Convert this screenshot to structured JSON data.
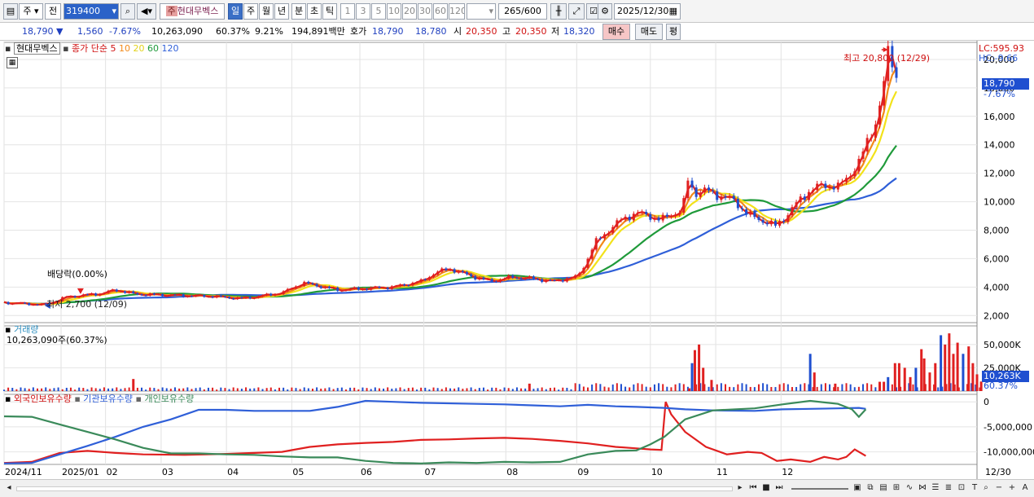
{
  "toolbar": {
    "market": "주",
    "prev": "전",
    "code": "319400",
    "stock_name": "현대무벡스",
    "periods": [
      "일",
      "주",
      "월",
      "년",
      "분",
      "초",
      "틱"
    ],
    "minutes": [
      "1",
      "3",
      "5",
      "10",
      "20",
      "30",
      "60",
      "120"
    ],
    "count": "265",
    "count_max": "/600",
    "date": "2025/12/30",
    "badge": "주"
  },
  "quote": {
    "price": "18,790",
    "change": "1,560",
    "change_pct": "-7.67%",
    "volume": "10,263,090",
    "vol_ratio": "60.37%",
    "turnover": "9.21%",
    "amount": "194,891백만",
    "bid_label": "호가",
    "ask": "18,790",
    "bid": "18,780",
    "open_label": "시",
    "open": "20,350",
    "high_label": "고",
    "high": "20,350",
    "low_label": "저",
    "low": "18,320",
    "buy": "매수",
    "sell": "매도",
    "eval": "평"
  },
  "legend": {
    "stock": "현대무벡스",
    "close_label": "종가 단순",
    "ma": [
      "5",
      "10",
      "20",
      "60",
      "120"
    ]
  },
  "annotations": {
    "max": "최고 20,800 (12/29)",
    "min": "최저 2,700 (12/09)",
    "dividend": "배당락(0.00%)",
    "lc": "LC:595.93",
    "hc": "HC:-9.66",
    "last_price": "18,790",
    "last_pct": "-7.67%"
  },
  "volume_panel": {
    "title": "거래량",
    "info": "10,263,090주(60.37%)",
    "last": "10,263K",
    "last_pct": "60.37%"
  },
  "holdings_panel": {
    "series": [
      "외국인보유수량",
      "기관보유수량",
      "개인보유수량"
    ]
  },
  "x_labels": [
    "2024/11",
    "2025/01",
    "02",
    "03",
    "04",
    "05",
    "06",
    "07",
    "08",
    "09",
    "10",
    "11",
    "12"
  ],
  "x_right": "12/30",
  "colors": {
    "up": "#e02020",
    "down": "#1f4fd0",
    "ma5": "#e02020",
    "ma10": "#f28a1a",
    "ma20": "#f2e21a",
    "ma60": "#1f9a3a",
    "ma120": "#2f5fd8",
    "foreign": "#e02020",
    "institution": "#2f5fd8",
    "individual": "#3a8a5a"
  },
  "chart_data": [
    {
      "type": "candlestick",
      "title": "현대무벡스",
      "ylim": [
        1500,
        21200
      ],
      "y_ticks": [
        2000,
        4000,
        6000,
        8000,
        10000,
        12000,
        14000,
        16000,
        18000,
        20000
      ],
      "y_tick_labels": [
        "2,000",
        "4,000",
        "6,000",
        "8,000",
        "10,000",
        "12,000",
        "14,000",
        "16,000",
        "18,000",
        "20,000"
      ],
      "x_months": [
        "2024/11",
        "2025/01",
        "02",
        "03",
        "04",
        "05",
        "06",
        "07",
        "08",
        "09",
        "10",
        "11",
        "12"
      ],
      "x_month_day": [
        0,
        41,
        73,
        113,
        160,
        207,
        256,
        302,
        361,
        412,
        465,
        512,
        559
      ],
      "close_points": [
        [
          0,
          2900
        ],
        [
          10,
          2850
        ],
        [
          20,
          2800
        ],
        [
          28,
          2750
        ],
        [
          35,
          2950
        ],
        [
          45,
          3300
        ],
        [
          55,
          3400
        ],
        [
          70,
          3550
        ],
        [
          80,
          3800
        ],
        [
          95,
          3500
        ],
        [
          110,
          3450
        ],
        [
          130,
          3400
        ],
        [
          150,
          3350
        ],
        [
          170,
          3200
        ],
        [
          180,
          3300
        ],
        [
          200,
          3600
        ],
        [
          215,
          4300
        ],
        [
          225,
          4100
        ],
        [
          240,
          3800
        ],
        [
          260,
          3900
        ],
        [
          280,
          4000
        ],
        [
          300,
          4400
        ],
        [
          310,
          5000
        ],
        [
          320,
          5300
        ],
        [
          335,
          4800
        ],
        [
          350,
          4400
        ],
        [
          365,
          4700
        ],
        [
          380,
          4600
        ],
        [
          395,
          4400
        ],
        [
          405,
          4600
        ],
        [
          412,
          4700
        ],
        [
          418,
          5600
        ],
        [
          425,
          7100
        ],
        [
          435,
          8000
        ],
        [
          445,
          8800
        ],
        [
          455,
          9200
        ],
        [
          465,
          9000
        ],
        [
          472,
          8700
        ],
        [
          480,
          9100
        ],
        [
          488,
          9400
        ],
        [
          492,
          11500
        ],
        [
          497,
          10600
        ],
        [
          505,
          10800
        ],
        [
          515,
          10400
        ],
        [
          525,
          10100
        ],
        [
          535,
          9100
        ],
        [
          545,
          8700
        ],
        [
          555,
          8300
        ],
        [
          563,
          9000
        ],
        [
          572,
          10100
        ],
        [
          580,
          10800
        ],
        [
          590,
          11200
        ],
        [
          600,
          11000
        ],
        [
          608,
          11900
        ],
        [
          615,
          12700
        ],
        [
          622,
          14500
        ],
        [
          628,
          15800
        ],
        [
          632,
          17500
        ],
        [
          636,
          20500
        ],
        [
          639,
          20000
        ],
        [
          642,
          18790
        ]
      ],
      "max_label": "최고 20,800 (12/29)",
      "min_label": "최저 2,700 (12/09)",
      "last_price": 18790,
      "last_change_pct": -7.67
    },
    {
      "type": "bar",
      "title": "거래량",
      "ylim": [
        0,
        70000
      ],
      "y_ticks": [
        25000,
        50000
      ],
      "y_tick_labels": [
        "25,000K",
        "50,000K"
      ],
      "spikes_k": [
        [
          93,
          13000
        ],
        [
          378,
          8000
        ],
        [
          493,
          3000
        ],
        [
          495,
          30000
        ],
        [
          497,
          44000
        ],
        [
          500,
          50000
        ],
        [
          503,
          25000
        ],
        [
          509,
          12000
        ],
        [
          580,
          40000
        ],
        [
          583,
          20000
        ],
        [
          598,
          8000
        ],
        [
          630,
          10000
        ],
        [
          633,
          10000
        ],
        [
          636,
          15000
        ],
        [
          641,
          30000
        ],
        [
          644,
          30000
        ],
        [
          648,
          25000
        ],
        [
          652,
          15000
        ],
        [
          656,
          25000
        ],
        [
          660,
          45000
        ],
        [
          662,
          35000
        ],
        [
          666,
          20000
        ],
        [
          670,
          30000
        ],
        [
          674,
          60000
        ],
        [
          677,
          50000
        ],
        [
          680,
          62000
        ],
        [
          683,
          40000
        ],
        [
          686,
          52000
        ],
        [
          690,
          40000
        ],
        [
          694,
          48000
        ],
        [
          697,
          30000
        ],
        [
          700,
          18000
        ],
        [
          703,
          10263
        ]
      ],
      "last_value_k": 10263
    },
    {
      "type": "line",
      "title": "외국인보유수량 / 기관보유수량 / 개인보유수량",
      "ylim": [
        -12500000,
        1500000
      ],
      "y_ticks": [
        0,
        -5000000,
        -10000000
      ],
      "y_tick_labels": [
        "0",
        "-5,000,000",
        "-10,000,000"
      ],
      "series": [
        {
          "name": "외국인보유수량",
          "points": [
            [
              0,
              -12200000
            ],
            [
              20,
              -12000000
            ],
            [
              40,
              -10200000
            ],
            [
              60,
              -9800000
            ],
            [
              80,
              -10200000
            ],
            [
              100,
              -10500000
            ],
            [
              130,
              -10600000
            ],
            [
              160,
              -10400000
            ],
            [
              200,
              -10000000
            ],
            [
              220,
              -9000000
            ],
            [
              240,
              -8500000
            ],
            [
              260,
              -8200000
            ],
            [
              280,
              -8000000
            ],
            [
              300,
              -7600000
            ],
            [
              320,
              -7500000
            ],
            [
              340,
              -7300000
            ],
            [
              360,
              -7200000
            ],
            [
              380,
              -7400000
            ],
            [
              400,
              -7800000
            ],
            [
              420,
              -8300000
            ],
            [
              440,
              -9000000
            ],
            [
              455,
              -9300000
            ],
            [
              465,
              -9500000
            ],
            [
              473,
              -9600000
            ],
            [
              476,
              0
            ],
            [
              480,
              -2500000
            ],
            [
              490,
              -6000000
            ],
            [
              505,
              -9000000
            ],
            [
              520,
              -10500000
            ],
            [
              535,
              -10000000
            ],
            [
              545,
              -10200000
            ],
            [
              556,
              -11800000
            ],
            [
              566,
              -11500000
            ],
            [
              580,
              -12000000
            ],
            [
              590,
              -11000000
            ],
            [
              600,
              -11500000
            ],
            [
              606,
              -11000000
            ],
            [
              612,
              -9500000
            ],
            [
              620,
              -10800000
            ]
          ]
        },
        {
          "name": "기관보유수량",
          "points": [
            [
              0,
              -12300000
            ],
            [
              20,
              -12200000
            ],
            [
              40,
              -10500000
            ],
            [
              60,
              -8800000
            ],
            [
              80,
              -7000000
            ],
            [
              100,
              -5000000
            ],
            [
              120,
              -3500000
            ],
            [
              140,
              -1600000
            ],
            [
              160,
              -1600000
            ],
            [
              180,
              -1800000
            ],
            [
              200,
              -1800000
            ],
            [
              220,
              -1800000
            ],
            [
              240,
              -1000000
            ],
            [
              260,
              200000
            ],
            [
              280,
              0
            ],
            [
              300,
              -200000
            ],
            [
              340,
              -400000
            ],
            [
              360,
              -500000
            ],
            [
              380,
              -700000
            ],
            [
              400,
              -900000
            ],
            [
              420,
              -600000
            ],
            [
              440,
              -900000
            ],
            [
              455,
              -1000000
            ],
            [
              475,
              -1200000
            ],
            [
              490,
              -1500000
            ],
            [
              510,
              -1700000
            ],
            [
              540,
              -1800000
            ],
            [
              560,
              -1500000
            ],
            [
              580,
              -1400000
            ],
            [
              600,
              -1300000
            ],
            [
              615,
              -1200000
            ],
            [
              620,
              -1400000
            ]
          ]
        },
        {
          "name": "개인보유수량",
          "points": [
            [
              0,
              -2900000
            ],
            [
              20,
              -3000000
            ],
            [
              40,
              -4500000
            ],
            [
              60,
              -6000000
            ],
            [
              80,
              -7500000
            ],
            [
              100,
              -9200000
            ],
            [
              120,
              -10300000
            ],
            [
              140,
              -10300000
            ],
            [
              160,
              -10500000
            ],
            [
              180,
              -10600000
            ],
            [
              200,
              -10900000
            ],
            [
              220,
              -11100000
            ],
            [
              240,
              -11100000
            ],
            [
              260,
              -11800000
            ],
            [
              280,
              -12200000
            ],
            [
              300,
              -12300000
            ],
            [
              320,
              -12100000
            ],
            [
              340,
              -12200000
            ],
            [
              360,
              -12000000
            ],
            [
              380,
              -12100000
            ],
            [
              400,
              -12000000
            ],
            [
              420,
              -10500000
            ],
            [
              440,
              -9800000
            ],
            [
              455,
              -9700000
            ],
            [
              465,
              -8500000
            ],
            [
              475,
              -7000000
            ],
            [
              490,
              -3500000
            ],
            [
              510,
              -1700000
            ],
            [
              540,
              -1300000
            ],
            [
              560,
              -500000
            ],
            [
              580,
              200000
            ],
            [
              600,
              -400000
            ],
            [
              610,
              -1500000
            ],
            [
              615,
              -3000000
            ],
            [
              620,
              -1500000
            ]
          ]
        }
      ]
    }
  ]
}
